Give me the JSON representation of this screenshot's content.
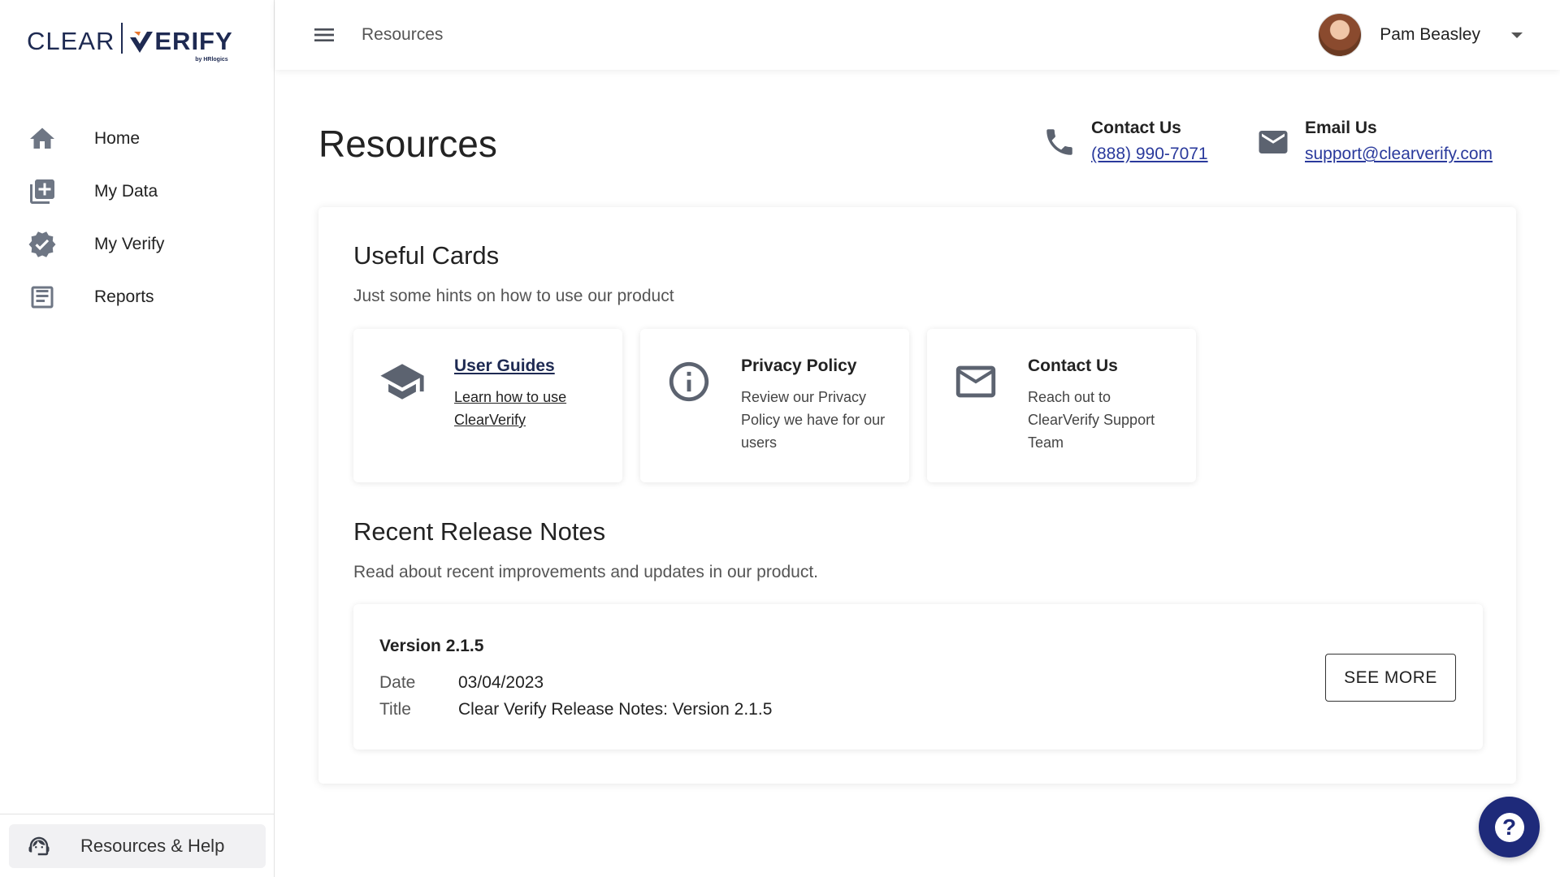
{
  "brand": {
    "clear": "CLEAR",
    "verify": "ERIFY",
    "by": "by HRlogics",
    "accent": "#e8762d",
    "navy": "#1e2a52"
  },
  "sidebar": {
    "items": [
      {
        "label": "Home",
        "icon": "home-icon"
      },
      {
        "label": "My Data",
        "icon": "data-icon"
      },
      {
        "label": "My Verify",
        "icon": "verified-badge-icon"
      },
      {
        "label": "Reports",
        "icon": "report-icon"
      }
    ],
    "help_label": "Resources & Help"
  },
  "topbar": {
    "breadcrumb": "Resources",
    "user_name": "Pam Beasley"
  },
  "main": {
    "title": "Resources",
    "contact": {
      "title": "Contact Us",
      "phone": "(888) 990-7071"
    },
    "email": {
      "title": "Email Us",
      "address": "support@clearverify.com"
    }
  },
  "useful": {
    "title": "Useful Cards",
    "subtitle": "Just some hints on how to use our product",
    "cards": [
      {
        "title": "User Guides",
        "text": "Learn how to use ClearVerify",
        "icon": "graduation-cap-icon"
      },
      {
        "title": "Privacy Policy",
        "text": "Review our Privacy Policy we have for our users",
        "icon": "info-icon"
      },
      {
        "title": "Contact Us",
        "text": "Reach out to ClearVerify Support Team",
        "icon": "mail-icon"
      }
    ]
  },
  "release": {
    "title": "Recent Release Notes",
    "subtitle": "Read about recent improvements and updates in our product.",
    "version": "Version 2.1.5",
    "date_label": "Date",
    "date_value": "03/04/2023",
    "title_label": "Title",
    "title_value": "Clear Verify Release Notes: Version 2.1.5",
    "see_more": "SEE MORE"
  },
  "fab": {
    "label": "?",
    "color": "#1e2a7a"
  }
}
